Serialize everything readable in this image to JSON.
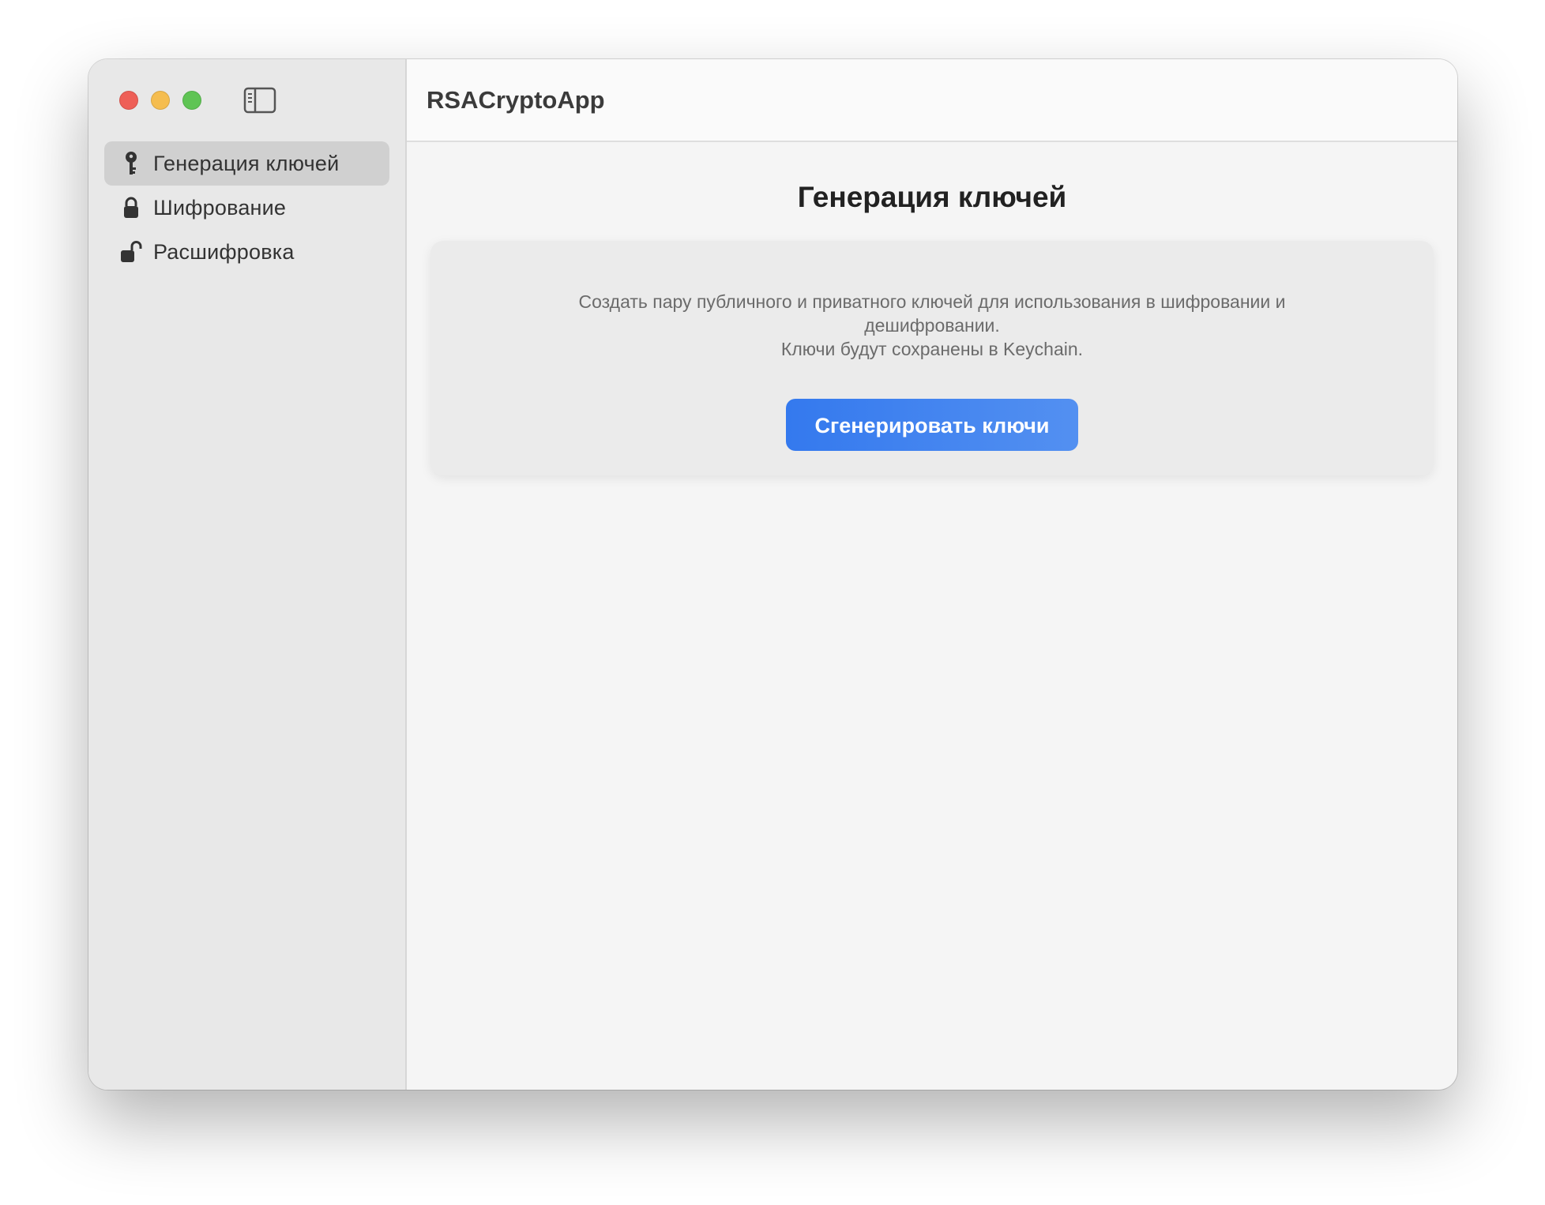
{
  "window": {
    "controls": [
      "close",
      "minimize",
      "maximize"
    ],
    "sidebar_toggle_icon": "sidebar-toggle-icon"
  },
  "sidebar": {
    "items": [
      {
        "label": "Генерация ключей",
        "icon": "key-icon",
        "active": true
      },
      {
        "label": "Шифрование",
        "icon": "lock-icon",
        "active": false
      },
      {
        "label": "Расшифровка",
        "icon": "unlock-icon",
        "active": false
      }
    ]
  },
  "toolbar": {
    "title": "RSACryptoApp"
  },
  "main": {
    "title": "Генерация ключей",
    "description_lines": [
      "Создать пару публичного и приватного ключей для использования в шифровании и дешифровании.",
      "Ключи будут сохранены в Keychain."
    ],
    "button_label": "Сгенерировать ключи"
  },
  "colors": {
    "accent": "#3479ee",
    "sidebar_bg": "#e8e8e8",
    "selected_item_bg": "#d0d0d0"
  }
}
